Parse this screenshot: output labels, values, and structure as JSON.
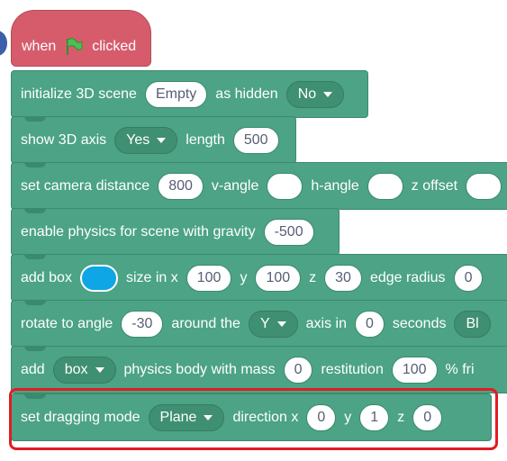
{
  "hat": {
    "when": "when",
    "clicked": "clicked"
  },
  "blocks": {
    "init": {
      "text1": "initialize 3D scene",
      "value1": "Empty",
      "text2": "as hidden",
      "dropdown": "No"
    },
    "axis": {
      "text1": "show 3D axis",
      "dropdown": "Yes",
      "text2": "length",
      "value": "500"
    },
    "camera": {
      "text1": "set camera distance",
      "value1": "800",
      "text2": "v-angle",
      "text3": "h-angle",
      "text4": "z offset"
    },
    "physics": {
      "text1": "enable physics for scene with gravity",
      "value": "-500"
    },
    "box": {
      "text1": "add box",
      "text2": "size in x",
      "x": "100",
      "text3": "y",
      "y": "100",
      "text4": "z",
      "z": "30",
      "text5": "edge radius",
      "radius": "0"
    },
    "rotate": {
      "text1": "rotate to angle",
      "angle": "-30",
      "text2": "around the",
      "dropdown": "Y",
      "text3": "axis in",
      "seconds_value": "0",
      "text4": "seconds",
      "cutoff": "Bl"
    },
    "add": {
      "text1": "add",
      "dropdown": "box",
      "text2": "physics body with mass",
      "mass": "0",
      "text3": "restitution",
      "restitution": "100",
      "cutoff": "% fri"
    },
    "drag": {
      "text1": "set dragging mode",
      "dropdown": "Plane",
      "text2": "direction x",
      "x": "0",
      "text3": "y",
      "y": "1",
      "text4": "z",
      "z": "0"
    }
  },
  "colors": {
    "hat": "#d65c6c",
    "block": "#4ca385",
    "highlight": "#e31b23",
    "box_color": "#0ea6e4"
  }
}
